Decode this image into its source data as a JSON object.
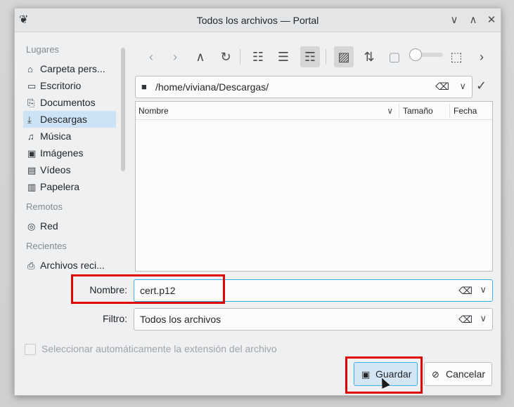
{
  "window": {
    "title": "Todos los archivos — Portal",
    "app_icon_glyph": "❦",
    "min_glyph": "∨",
    "max_glyph": "∧",
    "close_glyph": "✕"
  },
  "sidebar": {
    "sections": {
      "places": "Lugares",
      "remote": "Remotos",
      "recent": "Recientes"
    },
    "places": [
      {
        "label": "Carpeta pers...",
        "icon": "home-icon",
        "glyph": "⌂"
      },
      {
        "label": "Escritorio",
        "icon": "desktop-icon",
        "glyph": "▭"
      },
      {
        "label": "Documentos",
        "icon": "documents-icon",
        "glyph": "⎘"
      },
      {
        "label": "Descargas",
        "icon": "downloads-icon",
        "glyph": "⤓"
      },
      {
        "label": "Música",
        "icon": "music-icon",
        "glyph": "♫"
      },
      {
        "label": "Imágenes",
        "icon": "pictures-icon",
        "glyph": "▣"
      },
      {
        "label": "Vídeos",
        "icon": "videos-icon",
        "glyph": "▤"
      },
      {
        "label": "Papelera",
        "icon": "trash-icon",
        "glyph": "▥"
      }
    ],
    "remote": [
      {
        "label": "Red",
        "icon": "network-icon",
        "glyph": "◎"
      }
    ],
    "recent": [
      {
        "label": "Archivos reci...",
        "icon": "recent-files-icon",
        "glyph": "⎙"
      }
    ],
    "active_item": "Descargas"
  },
  "toolbar": {
    "back": "‹",
    "forward": "›",
    "up": "∧",
    "reload": "↻",
    "icons_view": "☷",
    "compact_view": "☰",
    "detail_view": "☶",
    "preview": "▨",
    "sort": "⇅",
    "hidden": "▢",
    "zoom_fit": "⬚",
    "more": "›"
  },
  "pathbar": {
    "path": "/home/viviana/Descargas/",
    "folder_glyph": "■",
    "clear_glyph": "⌫",
    "dropdown_glyph": "∨",
    "ok_glyph": "✓"
  },
  "filelist": {
    "columns": [
      "Nombre",
      "Tamaño",
      "Fecha"
    ],
    "sort_glyph": "∨"
  },
  "form": {
    "name_label": "Nombre:",
    "name_value": "cert.p12",
    "filter_label": "Filtro:",
    "filter_value": "Todos los archivos",
    "clear_glyph": "⌫",
    "dropdown_glyph": "∨"
  },
  "options": {
    "auto_extension_label": "Seleccionar automáticamente la extensión del archivo",
    "auto_extension_checked": false
  },
  "buttons": {
    "save_label": "Guardar",
    "save_glyph": "▣",
    "cancel_label": "Cancelar",
    "cancel_glyph": "⊘"
  },
  "colors": {
    "accent": "#3daee9",
    "highlight": "#e00000",
    "selection": "#cde3f5"
  }
}
